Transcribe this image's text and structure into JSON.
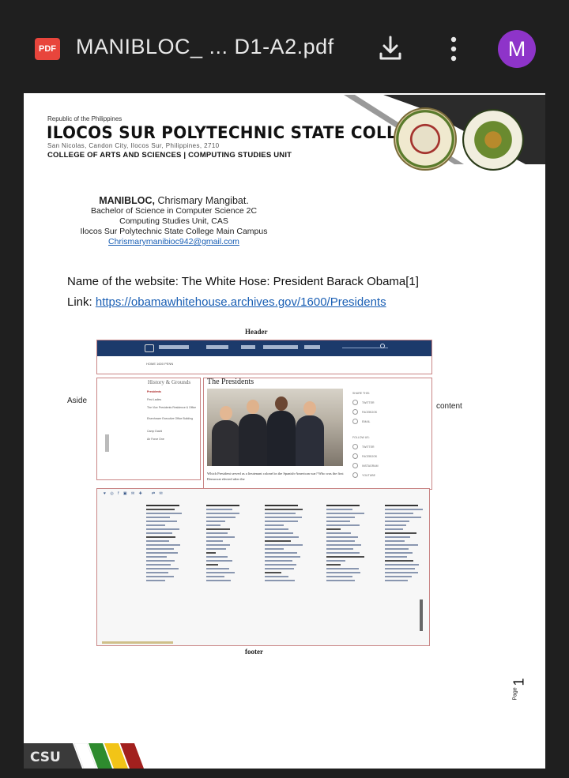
{
  "viewer": {
    "file_badge": "PDF",
    "file_name": "MANIBLOC_ ... D1-A2.pdf",
    "avatar_letter": "M"
  },
  "doc_header": {
    "republic": "Republic of the Philippines",
    "college": "ILOCOS SUR POLYTECHNIC STATE COLLEGE",
    "address": "San Nicolas, Candon City, Ilocos Sur, Philippines, 2710",
    "unit": "COLLEGE OF ARTS AND SCIENCES | COMPUTING STUDIES UNIT"
  },
  "author": {
    "surname": "MANIBLOC,",
    "given": " Chrismary Mangibat.",
    "program": "Bachelor of Science in Computer Science 2C",
    "unit": "Computing Studies Unit, CAS",
    "campus": "Ilocos Sur Polytechnic State College Main Campus",
    "email": "Chrismarymanibioc942@gmail.com"
  },
  "website": {
    "name_line": "Name of the website: The White Hose: President Barack Obama[1]",
    "link_label": "Link: ",
    "link_url": "https://obamawhitehouse.archives.gov/1600/Presidents"
  },
  "labels": {
    "header": "Header",
    "aside": "Aside",
    "content": "content",
    "footer": "footer"
  },
  "mock": {
    "crumb": "HOME   1600 PENN",
    "aside_title": "History & Grounds",
    "aside_items": [
      "Presidents",
      "First Ladies",
      "The Vice Presidents Residence & Office",
      "Eisenhower Executive Office Building",
      "Camp David",
      "Air Force One"
    ],
    "content_title": "The Presidents",
    "caption": "Which President served as a lieutenant colonel in the Spanish-American war? Who was the first Democrat elected after the",
    "share_label": "SHARE THIS:",
    "share_items": [
      "TWITTER",
      "FACEBOOK",
      "EMAIL"
    ],
    "follow_label": "FOLLOW US:",
    "follow_items": [
      "TWITTER",
      "FACEBOOK",
      "INSTAGRAM",
      "YOUTUBE"
    ]
  },
  "page_footer": {
    "page_word": "Page",
    "page_number": "1",
    "logo_text": "CSU"
  },
  "colors": {
    "accent_pdf": "#e8453c",
    "avatar": "#8e34c9",
    "link": "#1a5fb4",
    "wh_navy": "#1c3a6b"
  }
}
